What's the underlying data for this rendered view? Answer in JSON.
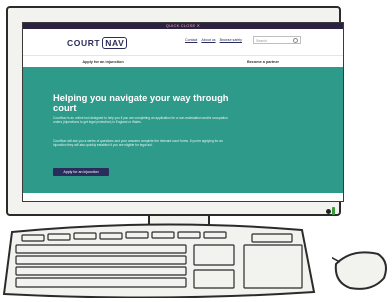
{
  "site": {
    "quick_close": "QUICK CLOSE",
    "logo_left": "COURT",
    "logo_right": "NAV",
    "top_links": [
      "Contact",
      "About us",
      "Browse safely"
    ],
    "search_placeholder": "Search"
  },
  "tabs": [
    "Apply for an injunction",
    "Become a partner"
  ],
  "hero": {
    "title": "Helping you navigate your way through court",
    "paragraph_1": "CourtNav is an online tool designed to help you if you are completing an application for a non-molestation and/or occupation orders (injunctions to get legal protection) in England or Wales.",
    "paragraph_2": "CourtNav will ask you a series of questions and your answers complete the relevant court forms. If you're applying for an injunction they will also quickly establish if you are eligible for legal aid.",
    "button": "Apply for an injunction"
  },
  "colors": {
    "brand_navy": "#2a2d5c",
    "hero_teal": "#2e9a8a",
    "quick_close_bar": "#2b2240"
  },
  "icons": {
    "search": "search-icon",
    "close": "close-icon"
  }
}
